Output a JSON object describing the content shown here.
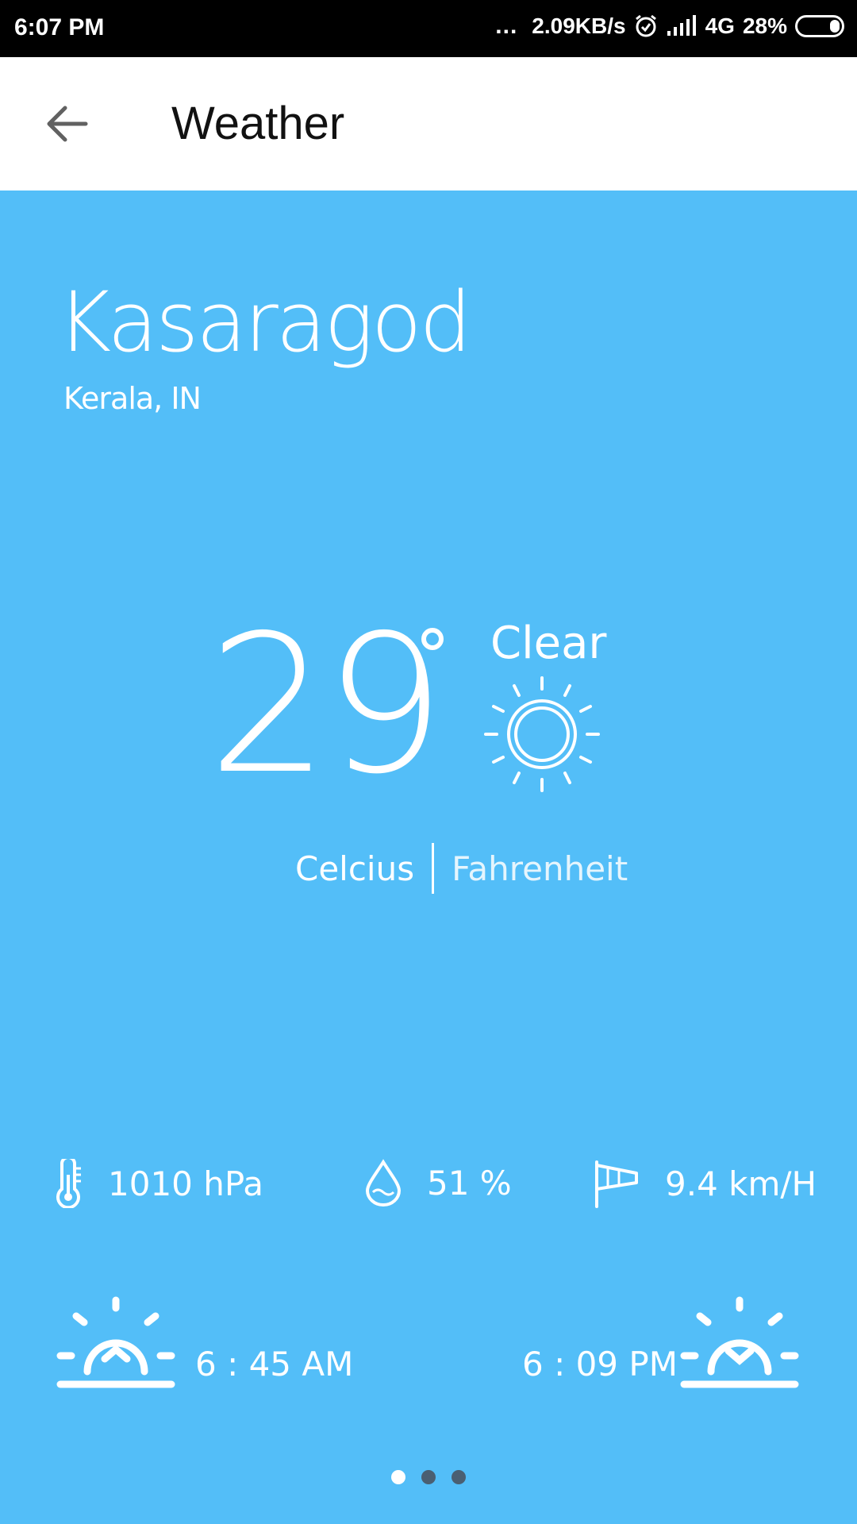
{
  "status_bar": {
    "time": "6:07 PM",
    "dots": "...",
    "speed": "2.09KB/s",
    "network": "4G",
    "battery": "28%"
  },
  "app_bar": {
    "title": "Weather",
    "back_icon": "arrow-back-icon"
  },
  "location": {
    "city": "Kasaragod",
    "region": "Kerala, IN"
  },
  "current": {
    "temperature": "29",
    "condition": "Clear",
    "condition_icon": "sun-icon"
  },
  "units": {
    "celcius": "Celcius",
    "fahrenheit": "Fahrenheit",
    "selected": "Celcius"
  },
  "metrics": {
    "pressure": "1010 hPa",
    "humidity": "51 %",
    "wind": "9.4 km/H"
  },
  "sun": {
    "sunrise": "6 : 45 AM",
    "sunset": "6 : 09 PM"
  },
  "pager": {
    "count": 3,
    "active_index": 0
  },
  "colors": {
    "background": "#53bef8",
    "app_bar": "#ffffff",
    "status_bar": "#000000"
  }
}
